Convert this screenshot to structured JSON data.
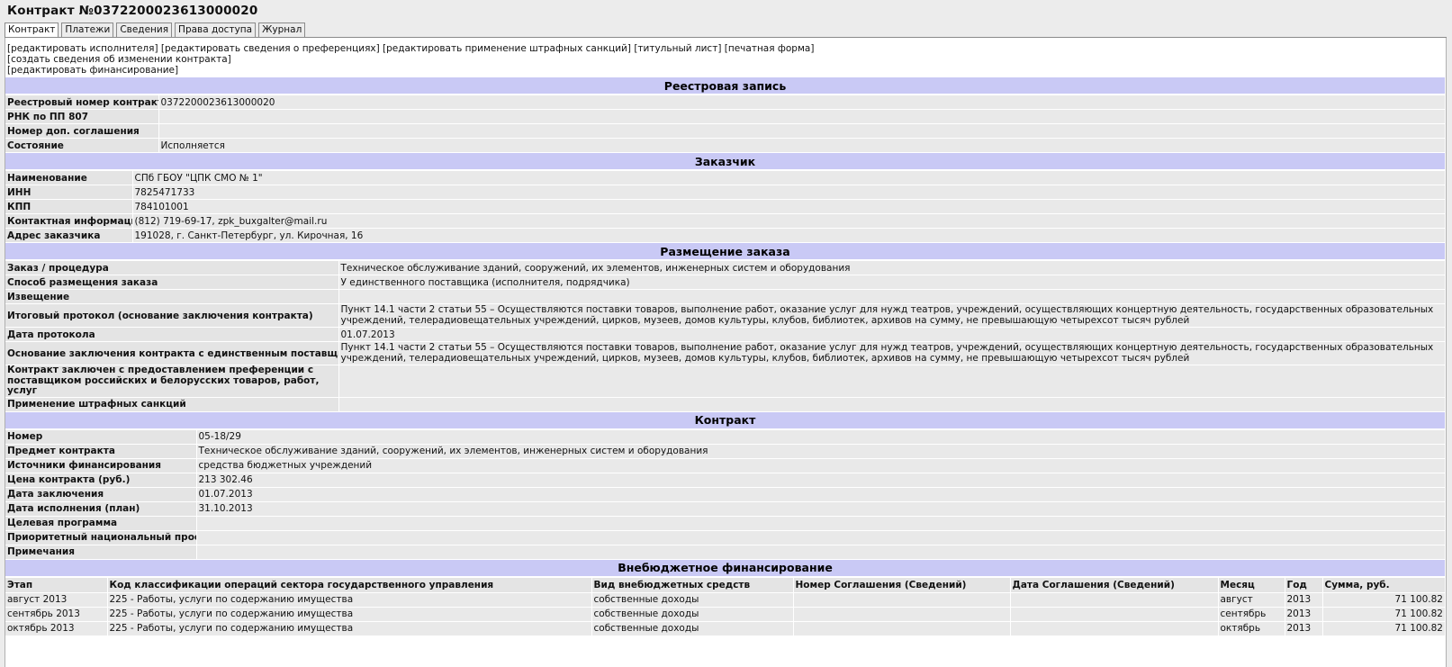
{
  "page_title": "Контракт №0372200023613000020",
  "tabs": [
    {
      "label": "Контракт"
    },
    {
      "label": "Платежи"
    },
    {
      "label": "Сведения"
    },
    {
      "label": "Права доступа"
    },
    {
      "label": "Журнал"
    }
  ],
  "actions": {
    "edit_executor": "[редактировать исполнителя]",
    "edit_preferences": "[редактировать сведения о преференциях]",
    "edit_penalties": "[редактировать применение штрафных санкций]",
    "title_page": "[титульный лист]",
    "print_form": "[печатная форма]",
    "create_change": "[создать сведения об изменении контракта]",
    "edit_financing": "[редактировать финансирование]"
  },
  "registry": {
    "header": "Реестровая запись",
    "rows": [
      {
        "label": "Реестровый номер контракта",
        "value": "0372200023613000020"
      },
      {
        "label": "РНК по ПП 807",
        "value": ""
      },
      {
        "label": "Номер доп. соглашения",
        "value": ""
      },
      {
        "label": "Состояние",
        "value": "Исполняется"
      }
    ]
  },
  "customer": {
    "header": "Заказчик",
    "rows": [
      {
        "label": "Наименование",
        "value": "СПб ГБОУ \"ЦПК СМО № 1\""
      },
      {
        "label": "ИНН",
        "value": "7825471733"
      },
      {
        "label": "КПП",
        "value": "784101001"
      },
      {
        "label": "Контактная информация",
        "value": "(812) 719-69-17, zpk_buxgalter@mail.ru"
      },
      {
        "label": "Адрес заказчика",
        "value": "191028, г. Санкт-Петербург, ул. Кирочная, 16"
      }
    ]
  },
  "placement": {
    "header": "Размещение заказа",
    "rows": [
      {
        "label": "Заказ / процедура",
        "value": "Техническое обслуживание зданий, сооружений, их элементов, инженерных систем и оборудования"
      },
      {
        "label": "Способ размещения заказа",
        "value": "У единственного поставщика (исполнителя, подрядчика)"
      },
      {
        "label": "Извещение",
        "value": ""
      },
      {
        "label": "Итоговый протокол (основание заключения контракта)",
        "value": "Пункт 14.1 части 2 статьи 55 – Осуществляются поставки товаров, выполнение работ, оказание услуг для нужд театров, учреждений, осуществляющих концертную деятельность, государственных образовательных учреждений, телерадиовещательных учреждений, цирков, музеев, домов культуры, клубов, библиотек, архивов на сумму, не превышающую четырехсот тысяч рублей"
      },
      {
        "label": "Дата протокола",
        "value": "01.07.2013"
      },
      {
        "label": "Основание заключения контракта с единственным поставщиком",
        "value": "Пункт 14.1 части 2 статьи 55 – Осуществляются поставки товаров, выполнение работ, оказание услуг для нужд театров, учреждений, осуществляющих концертную деятельность, государственных образовательных учреждений, телерадиовещательных учреждений, цирков, музеев, домов культуры, клубов, библиотек, архивов на сумму, не превышающую четырехсот тысяч рублей"
      },
      {
        "label": "Контракт заключен с предоставлением преференции с поставщиком российских и белорусских товаров, работ, услуг",
        "value": ""
      },
      {
        "label": "Применение штрафных санкций",
        "value": ""
      }
    ]
  },
  "contract": {
    "header": "Контракт",
    "rows": [
      {
        "label": "Номер",
        "value": "05-18/29"
      },
      {
        "label": "Предмет контракта",
        "value": "Техническое обслуживание зданий, сооружений, их элементов, инженерных систем и оборудования"
      },
      {
        "label": "Источники финансирования",
        "value": "средства бюджетных учреждений"
      },
      {
        "label": "Цена контракта (руб.)",
        "value": "213 302.46"
      },
      {
        "label": "Дата заключения",
        "value": "01.07.2013"
      },
      {
        "label": "Дата исполнения (план)",
        "value": "31.10.2013"
      },
      {
        "label": "Целевая программа",
        "value": ""
      },
      {
        "label": "Приоритетный национальный проект",
        "value": ""
      },
      {
        "label": "Примечания",
        "value": ""
      }
    ]
  },
  "financing": {
    "header": "Внебюджетное финансирование",
    "columns": [
      "Этап",
      "Код классификации операций сектора государственного управления",
      "Вид внебюджетных средств",
      "Номер Соглашения (Сведений)",
      "Дата Соглашения (Сведений)",
      "Месяц",
      "Год",
      "Сумма, руб."
    ],
    "rows": [
      [
        "август 2013",
        "225 - Работы, услуги по содержанию имущества",
        "собственные доходы",
        "",
        "",
        "август",
        "2013",
        "71 100.82"
      ],
      [
        "сентябрь 2013",
        "225 - Работы, услуги по содержанию имущества",
        "собственные доходы",
        "",
        "",
        "сентябрь",
        "2013",
        "71 100.82"
      ],
      [
        "октябрь 2013",
        "225 - Работы, услуги по содержанию имущества",
        "собственные доходы",
        "",
        "",
        "октябрь",
        "2013",
        "71 100.82"
      ]
    ]
  }
}
